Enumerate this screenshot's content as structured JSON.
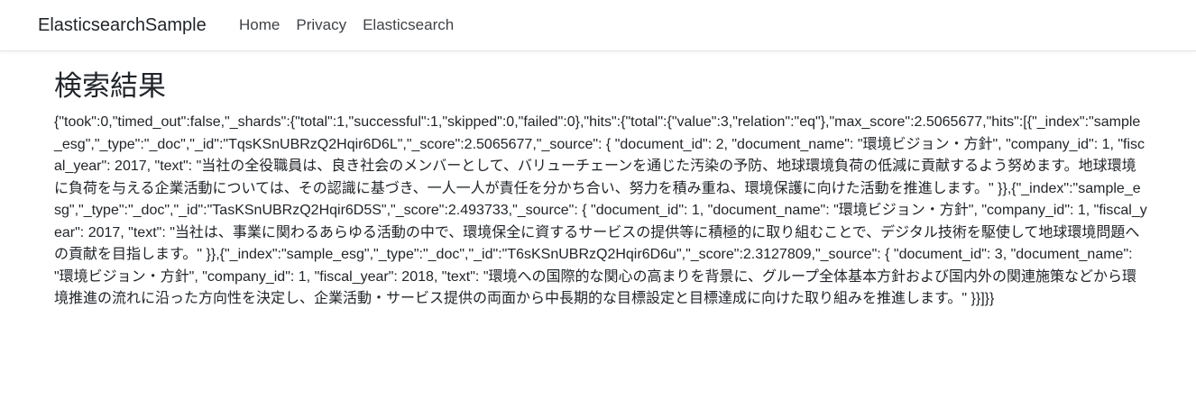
{
  "navbar": {
    "brand": "ElasticsearchSample",
    "links": [
      {
        "label": "Home"
      },
      {
        "label": "Privacy"
      },
      {
        "label": "Elasticsearch"
      }
    ]
  },
  "main": {
    "title": "検索結果",
    "json_text": "{\"took\":0,\"timed_out\":false,\"_shards\":{\"total\":1,\"successful\":1,\"skipped\":0,\"failed\":0},\"hits\":{\"total\":{\"value\":3,\"relation\":\"eq\"},\"max_score\":2.5065677,\"hits\":[{\"_index\":\"sample_esg\",\"_type\":\"_doc\",\"_id\":\"TqsKSnUBRzQ2Hqir6D6L\",\"_score\":2.5065677,\"_source\": { \"document_id\": 2, \"document_name\": \"環境ビジョン・方針\", \"company_id\": 1, \"fiscal_year\": 2017, \"text\": \"当社の全役職員は、良き社会のメンバーとして、バリューチェーンを通じた汚染の予防、地球環境負荷の低減に貢献するよう努めます。地球環境に負荷を与える企業活動については、その認識に基づき、一人一人が責任を分かち合い、努力を積み重ね、環境保護に向けた活動を推進します。\" }},{\"_index\":\"sample_esg\",\"_type\":\"_doc\",\"_id\":\"TasKSnUBRzQ2Hqir6D5S\",\"_score\":2.493733,\"_source\": { \"document_id\": 1, \"document_name\": \"環境ビジョン・方針\", \"company_id\": 1, \"fiscal_year\": 2017, \"text\": \"当社は、事業に関わるあらゆる活動の中で、環境保全に資するサービスの提供等に積極的に取り組むことで、デジタル技術を駆使して地球環境問題への貢献を目指します。\" }},{\"_index\":\"sample_esg\",\"_type\":\"_doc\",\"_id\":\"T6sKSnUBRzQ2Hqir6D6u\",\"_score\":2.3127809,\"_source\": { \"document_id\": 3, \"document_name\": \"環境ビジョン・方針\", \"company_id\": 1, \"fiscal_year\": 2018, \"text\": \"環境への国際的な関心の高まりを背景に、グループ全体基本方針および国内外の関連施策などから環境推進の流れに沿った方向性を決定し、企業活動・サービス提供の両面から中長期的な目標設定と目標達成に向けた取り組みを推進します。\" }}]}}"
  }
}
